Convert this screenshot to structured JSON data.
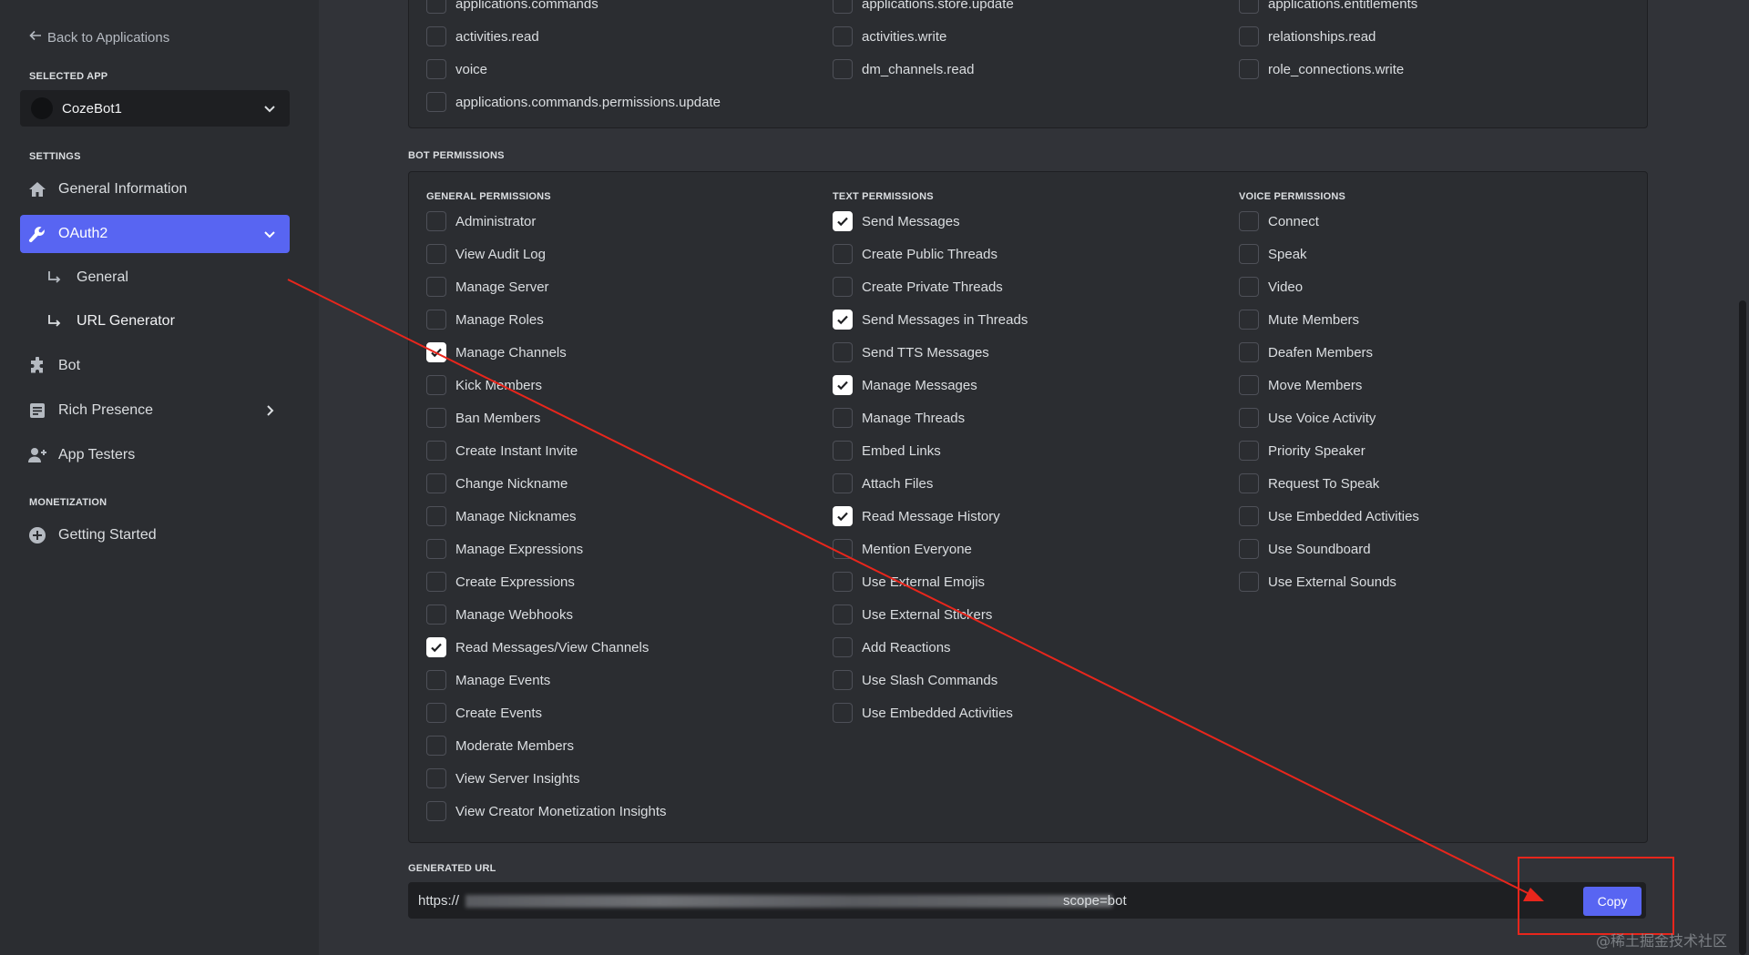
{
  "sidebar": {
    "back_label": "Back to Applications",
    "selected_app_heading": "SELECTED APP",
    "selected_app_name": "CozeBot1",
    "settings_heading": "SETTINGS",
    "items": {
      "general_information": "General Information",
      "oauth2": "OAuth2",
      "general": "General",
      "url_generator": "URL Generator",
      "bot": "Bot",
      "rich_presence": "Rich Presence",
      "app_testers": "App Testers"
    },
    "monetization_heading": "MONETIZATION",
    "getting_started": "Getting Started"
  },
  "scopes": {
    "columns": [
      [
        {
          "label": "applications.commands",
          "checked": false
        },
        {
          "label": "activities.read",
          "checked": false
        },
        {
          "label": "voice",
          "checked": false
        },
        {
          "label": "applications.commands.permissions.update",
          "checked": false
        }
      ],
      [
        {
          "label": "applications.store.update",
          "checked": false
        },
        {
          "label": "activities.write",
          "checked": false
        },
        {
          "label": "dm_channels.read",
          "checked": false
        }
      ],
      [
        {
          "label": "applications.entitlements",
          "checked": false
        },
        {
          "label": "relationships.read",
          "checked": false
        },
        {
          "label": "role_connections.write",
          "checked": false
        }
      ]
    ]
  },
  "bot_permissions": {
    "heading": "BOT PERMISSIONS",
    "columns": [
      {
        "heading": "GENERAL PERMISSIONS",
        "items": [
          {
            "label": "Administrator",
            "checked": false
          },
          {
            "label": "View Audit Log",
            "checked": false
          },
          {
            "label": "Manage Server",
            "checked": false
          },
          {
            "label": "Manage Roles",
            "checked": false
          },
          {
            "label": "Manage Channels",
            "checked": true
          },
          {
            "label": "Kick Members",
            "checked": false
          },
          {
            "label": "Ban Members",
            "checked": false
          },
          {
            "label": "Create Instant Invite",
            "checked": false
          },
          {
            "label": "Change Nickname",
            "checked": false
          },
          {
            "label": "Manage Nicknames",
            "checked": false
          },
          {
            "label": "Manage Expressions",
            "checked": false
          },
          {
            "label": "Create Expressions",
            "checked": false
          },
          {
            "label": "Manage Webhooks",
            "checked": false
          },
          {
            "label": "Read Messages/View Channels",
            "checked": true
          },
          {
            "label": "Manage Events",
            "checked": false
          },
          {
            "label": "Create Events",
            "checked": false
          },
          {
            "label": "Moderate Members",
            "checked": false
          },
          {
            "label": "View Server Insights",
            "checked": false
          },
          {
            "label": "View Creator Monetization Insights",
            "checked": false
          }
        ]
      },
      {
        "heading": "TEXT PERMISSIONS",
        "items": [
          {
            "label": "Send Messages",
            "checked": true
          },
          {
            "label": "Create Public Threads",
            "checked": false
          },
          {
            "label": "Create Private Threads",
            "checked": false
          },
          {
            "label": "Send Messages in Threads",
            "checked": true
          },
          {
            "label": "Send TTS Messages",
            "checked": false
          },
          {
            "label": "Manage Messages",
            "checked": true
          },
          {
            "label": "Manage Threads",
            "checked": false
          },
          {
            "label": "Embed Links",
            "checked": false
          },
          {
            "label": "Attach Files",
            "checked": false
          },
          {
            "label": "Read Message History",
            "checked": true
          },
          {
            "label": "Mention Everyone",
            "checked": false
          },
          {
            "label": "Use External Emojis",
            "checked": false
          },
          {
            "label": "Use External Stickers",
            "checked": false
          },
          {
            "label": "Add Reactions",
            "checked": false
          },
          {
            "label": "Use Slash Commands",
            "checked": false
          },
          {
            "label": "Use Embedded Activities",
            "checked": false
          }
        ]
      },
      {
        "heading": "VOICE PERMISSIONS",
        "items": [
          {
            "label": "Connect",
            "checked": false
          },
          {
            "label": "Speak",
            "checked": false
          },
          {
            "label": "Video",
            "checked": false
          },
          {
            "label": "Mute Members",
            "checked": false
          },
          {
            "label": "Deafen Members",
            "checked": false
          },
          {
            "label": "Move Members",
            "checked": false
          },
          {
            "label": "Use Voice Activity",
            "checked": false
          },
          {
            "label": "Priority Speaker",
            "checked": false
          },
          {
            "label": "Request To Speak",
            "checked": false
          },
          {
            "label": "Use Embedded Activities",
            "checked": false
          },
          {
            "label": "Use Soundboard",
            "checked": false
          },
          {
            "label": "Use External Sounds",
            "checked": false
          }
        ]
      }
    ]
  },
  "generated_url": {
    "heading": "GENERATED URL",
    "value_start": "https://",
    "value_end": "scope=bot",
    "copy_label": "Copy"
  },
  "watermark": "@稀土掘金技术社区",
  "colors": {
    "accent": "#5865f2",
    "annotation": "#e8261c",
    "sidebar_bg": "#2b2d31",
    "main_bg": "#313338"
  }
}
